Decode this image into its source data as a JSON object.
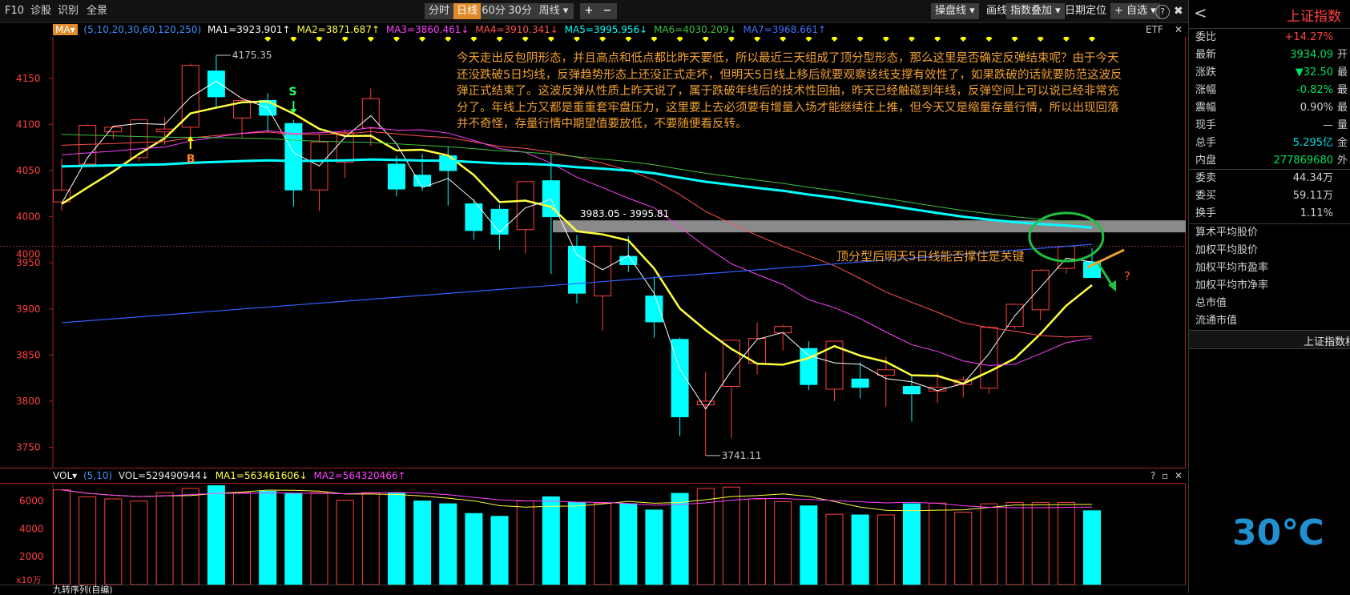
{
  "topbar": {
    "left_items": [
      "F10",
      "诊股",
      "识别",
      "全景"
    ],
    "periods": [
      "分时",
      "日线",
      "60分",
      "30分",
      "周线 ▾"
    ],
    "active_period": "日线",
    "zoom_in": "+",
    "zoom_out": "−",
    "right_items": [
      "操盘线 ▾",
      "画线",
      "指数叠加 ▾",
      "日期定位",
      "+ 自选 ▾"
    ],
    "help": "?",
    "close": "✖"
  },
  "ma_bar": {
    "selector": "MA▾",
    "params": "(5,10,20,30,60,120,250)",
    "ma1": "MA1=3923.901↑",
    "ma2": "MA2=3871.687↑",
    "ma3": "MA3=3860.461↓",
    "ma4": "MA4=3910.341↓",
    "ma5": "MA5=3995.956↓",
    "ma6": "MA6=4030.209↓",
    "ma7": "MA7=3968.661↑",
    "etf": "ETF",
    "close": "✕",
    "colors": {
      "ma1": "#ffffff",
      "ma2": "#ffff40",
      "ma3": "#ff40ff",
      "ma4": "#ff5050",
      "ma5": "#00ffff",
      "ma6": "#40c040",
      "ma7": "#3060ff"
    }
  },
  "price_axis": {
    "ticks": [
      "4150",
      "4100",
      "4050",
      "4000",
      "3950",
      "3900",
      "3850",
      "3800",
      "3750"
    ],
    "partial": "4000"
  },
  "annotations": {
    "high_label": "4175.35",
    "low_label": "3741.11",
    "zone_label": "3983.05 - 3995.81",
    "s_marker": "S",
    "b_marker": "B",
    "question": "?",
    "text_lines": [
      "今天走出反包阴形态，并且高点和低点都比昨天要低，所以最近三天组成了顶分型形态，那么这里是否确定反弹结束呢？由于今天",
      "还没跌破5日均线，反弹趋势形态上还没正式走坏，但明天5日线上移后就要观察该线支撑有效性了，如果跌破的话就要防范这波反",
      "弹正式结束了。这波反弹从性质上昨天说了，属于跌破年线后的技术性回抽，昨天已经触碰到年线，反弹空间上可以说已经非常充",
      "分了。年线上方又都是重重套牢盘压力，这里要上去必须要有增量入场才能继续往上推，但今天又是缩量存量行情，所以出现回落",
      "并不奇怪，存量行情中期望值要放低，不要随便看反转。"
    ],
    "note": "顶分型后明天5日线能否撑住是关键"
  },
  "chart_data": {
    "type": "candlestick",
    "ylim": [
      3727,
      4195
    ],
    "ylabel": "",
    "candles": [
      {
        "o": 4016,
        "h": 4063,
        "l": 4006,
        "c": 4029
      },
      {
        "o": 4057,
        "h": 4100,
        "l": 4054,
        "c": 4099
      },
      {
        "o": 4092,
        "h": 4099,
        "l": 4084,
        "c": 4097
      },
      {
        "o": 4064,
        "h": 4106,
        "l": 4060,
        "c": 4105
      },
      {
        "o": 4092,
        "h": 4108,
        "l": 4078,
        "c": 4095
      },
      {
        "o": 4097,
        "h": 4166,
        "l": 4075,
        "c": 4164
      },
      {
        "o": 4158,
        "h": 4175,
        "l": 4117,
        "c": 4130
      },
      {
        "o": 4107,
        "h": 4127,
        "l": 4086,
        "c": 4126
      },
      {
        "o": 4126,
        "h": 4134,
        "l": 4092,
        "c": 4110
      },
      {
        "o": 4101,
        "h": 4105,
        "l": 4011,
        "c": 4029
      },
      {
        "o": 4029,
        "h": 4089,
        "l": 4006,
        "c": 4081
      },
      {
        "o": 4059,
        "h": 4095,
        "l": 4042,
        "c": 4091
      },
      {
        "o": 4096,
        "h": 4139,
        "l": 4077,
        "c": 4128
      },
      {
        "o": 4057,
        "h": 4066,
        "l": 4022,
        "c": 4030
      },
      {
        "o": 4045,
        "h": 4068,
        "l": 4028,
        "c": 4033
      },
      {
        "o": 4066,
        "h": 4076,
        "l": 4012,
        "c": 4050
      },
      {
        "o": 4014,
        "h": 4019,
        "l": 3975,
        "c": 3985
      },
      {
        "o": 4008,
        "h": 4013,
        "l": 3964,
        "c": 3981
      },
      {
        "o": 3986,
        "h": 4032,
        "l": 3960,
        "c": 4038
      },
      {
        "o": 4039,
        "h": 4067,
        "l": 3938,
        "c": 4000
      },
      {
        "o": 3968,
        "h": 3980,
        "l": 3906,
        "c": 3917
      },
      {
        "o": 3914,
        "h": 3969,
        "l": 3876,
        "c": 3968
      },
      {
        "o": 3957,
        "h": 3979,
        "l": 3940,
        "c": 3948
      },
      {
        "o": 3914,
        "h": 3935,
        "l": 3869,
        "c": 3886
      },
      {
        "o": 3867,
        "h": 3869,
        "l": 3762,
        "c": 3783
      },
      {
        "o": 3796,
        "h": 3832,
        "l": 3741,
        "c": 3800
      },
      {
        "o": 3816,
        "h": 3866,
        "l": 3760,
        "c": 3866
      },
      {
        "o": 3841,
        "h": 3885,
        "l": 3829,
        "c": 3868
      },
      {
        "o": 3874,
        "h": 3883,
        "l": 3855,
        "c": 3881
      },
      {
        "o": 3857,
        "h": 3865,
        "l": 3812,
        "c": 3818
      },
      {
        "o": 3813,
        "h": 3863,
        "l": 3800,
        "c": 3865
      },
      {
        "o": 3824,
        "h": 3842,
        "l": 3803,
        "c": 3815
      },
      {
        "o": 3828,
        "h": 3848,
        "l": 3794,
        "c": 3834
      },
      {
        "o": 3816,
        "h": 3829,
        "l": 3778,
        "c": 3808
      },
      {
        "o": 3811,
        "h": 3831,
        "l": 3798,
        "c": 3815
      },
      {
        "o": 3818,
        "h": 3827,
        "l": 3804,
        "c": 3823
      },
      {
        "o": 3814,
        "h": 3882,
        "l": 3808,
        "c": 3880
      },
      {
        "o": 3881,
        "h": 3906,
        "l": 3878,
        "c": 3905
      },
      {
        "o": 3899,
        "h": 3943,
        "l": 3888,
        "c": 3942
      },
      {
        "o": 3944,
        "h": 3968,
        "l": 3938,
        "c": 3968
      },
      {
        "o": 3951,
        "h": 3966,
        "l": 3935,
        "c": 3934
      }
    ],
    "volume": [
      6800,
      6300,
      6150,
      6000,
      6600,
      6900,
      7100,
      6600,
      6700,
      6550,
      6600,
      6050,
      6600,
      6550,
      6000,
      5800,
      5100,
      4900,
      6000,
      6300,
      5900,
      5850,
      5800,
      5350,
      6550,
      6900,
      7000,
      6150,
      5950,
      5650,
      5050,
      5000,
      5000,
      5800,
      5850,
      5200,
      5800,
      5900,
      5900,
      5900,
      5300
    ],
    "volume_axis": [
      "6000",
      "4000",
      "2000"
    ],
    "volume_unit": "x10万"
  },
  "volume_bar": {
    "selector": "VOL▾",
    "params": "(5,10)",
    "vol": "VOL=529490944↓",
    "ma1": "MA1=563461606↓",
    "ma2": "MA2=564320466↑",
    "help": "?",
    "max": "▫",
    "close": "✕"
  },
  "bottom_tab": "九转序列(自编)",
  "right_panel": {
    "back": "<",
    "title": "上证指数",
    "quotes": [
      {
        "label": "委比",
        "value": "+14.27%",
        "color": "#ff4040",
        "ext": ""
      },
      {
        "label": "最新",
        "value": "3934.09",
        "color": "#00e060",
        "ext": "开"
      },
      {
        "label": "涨跌",
        "value": "▼32.50",
        "color": "#00e060",
        "ext": "最"
      },
      {
        "label": "涨幅",
        "value": "-0.82%",
        "color": "#00e060",
        "ext": "最"
      },
      {
        "label": "震幅",
        "value": "0.90%",
        "color": "#d0d0d0",
        "ext": "最"
      },
      {
        "label": "现手",
        "value": "—",
        "color": "#d0d0d0",
        "ext": "量"
      },
      {
        "label": "总手",
        "value": "5.295亿",
        "color": "#00e0e0",
        "ext": "金"
      },
      {
        "label": "内盘",
        "value": "277869680",
        "color": "#00e060",
        "ext": "外"
      }
    ],
    "orders": [
      {
        "label": "委卖",
        "value": "44.34万",
        "color": "#d0d0d0"
      },
      {
        "label": "委买",
        "value": "59.11万",
        "color": "#d0d0d0"
      },
      {
        "label": "换手",
        "value": "1.11%",
        "color": "#d0d0d0"
      }
    ],
    "stats": [
      "算术平均股价",
      "加权平均股价",
      "加权平均市盈率",
      "加权平均市净率",
      "总市值",
      "流通市值"
    ],
    "section": "上证指数相关",
    "temperature": "30℃"
  }
}
